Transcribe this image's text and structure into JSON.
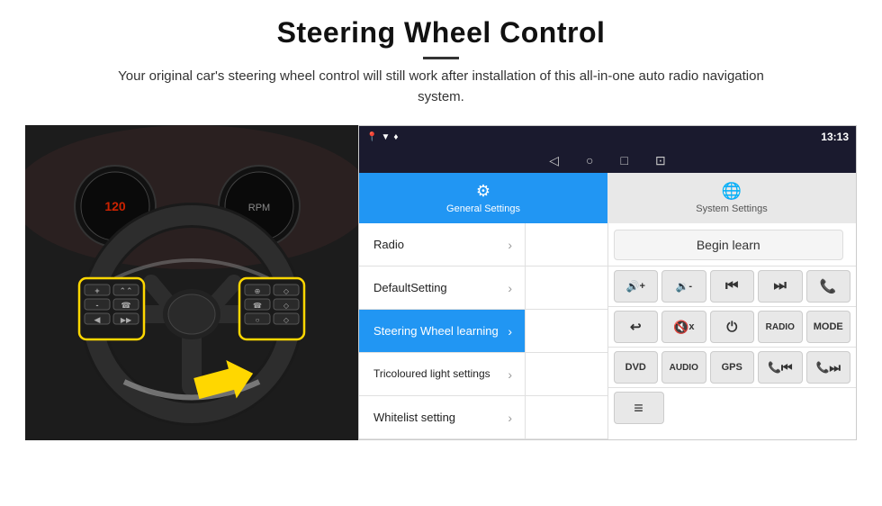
{
  "header": {
    "title": "Steering Wheel Control",
    "subtitle": "Your original car's steering wheel control will still work after installation of this all-in-one auto radio navigation system."
  },
  "status_bar": {
    "time": "13:13",
    "icons": [
      "▼",
      "♦",
      "●"
    ]
  },
  "nav_bar": {
    "icons": [
      "◁",
      "○",
      "□",
      "⊡"
    ]
  },
  "tabs": [
    {
      "id": "general",
      "label": "General Settings",
      "icon": "⚙",
      "active": true
    },
    {
      "id": "system",
      "label": "System Settings",
      "icon": "🌐",
      "active": false
    }
  ],
  "menu_items": [
    {
      "id": "radio",
      "label": "Radio",
      "active": false
    },
    {
      "id": "default",
      "label": "DefaultSetting",
      "active": false
    },
    {
      "id": "steering",
      "label": "Steering Wheel learning",
      "active": true
    },
    {
      "id": "tricoloured",
      "label": "Tricoloured light settings",
      "active": false
    },
    {
      "id": "whitelist",
      "label": "Whitelist setting",
      "active": false
    }
  ],
  "controls": {
    "begin_learn_label": "Begin learn",
    "grid_row1": [
      {
        "id": "vol_up",
        "icon": "🔊+",
        "label": "VOL+"
      },
      {
        "id": "vol_down",
        "icon": "🔊-",
        "label": "VOL-"
      },
      {
        "id": "prev",
        "icon": "⏮",
        "label": "PREV"
      },
      {
        "id": "next",
        "icon": "⏭",
        "label": "NEXT"
      },
      {
        "id": "phone",
        "icon": "📞",
        "label": "PHONE"
      }
    ],
    "grid_row2": [
      {
        "id": "hang_up",
        "icon": "↩",
        "label": "HANG"
      },
      {
        "id": "mute",
        "icon": "🔇",
        "label": "MUTE"
      },
      {
        "id": "power",
        "icon": "⏻",
        "label": "PWR"
      },
      {
        "id": "radio_btn",
        "icon": "",
        "label": "RADIO"
      },
      {
        "id": "mode",
        "icon": "",
        "label": "MODE"
      }
    ],
    "bottom_row": [
      {
        "id": "dvd",
        "label": "DVD"
      },
      {
        "id": "audio",
        "label": "AUDIO"
      },
      {
        "id": "gps",
        "label": "GPS"
      },
      {
        "id": "tel_prev",
        "icon": "📞⏮",
        "label": "TEL-PREV"
      },
      {
        "id": "tel_next",
        "icon": "📞⏭",
        "label": "TEL-NEXT"
      }
    ],
    "last_row": [
      {
        "id": "list_icon",
        "icon": "≡",
        "label": ""
      }
    ]
  }
}
